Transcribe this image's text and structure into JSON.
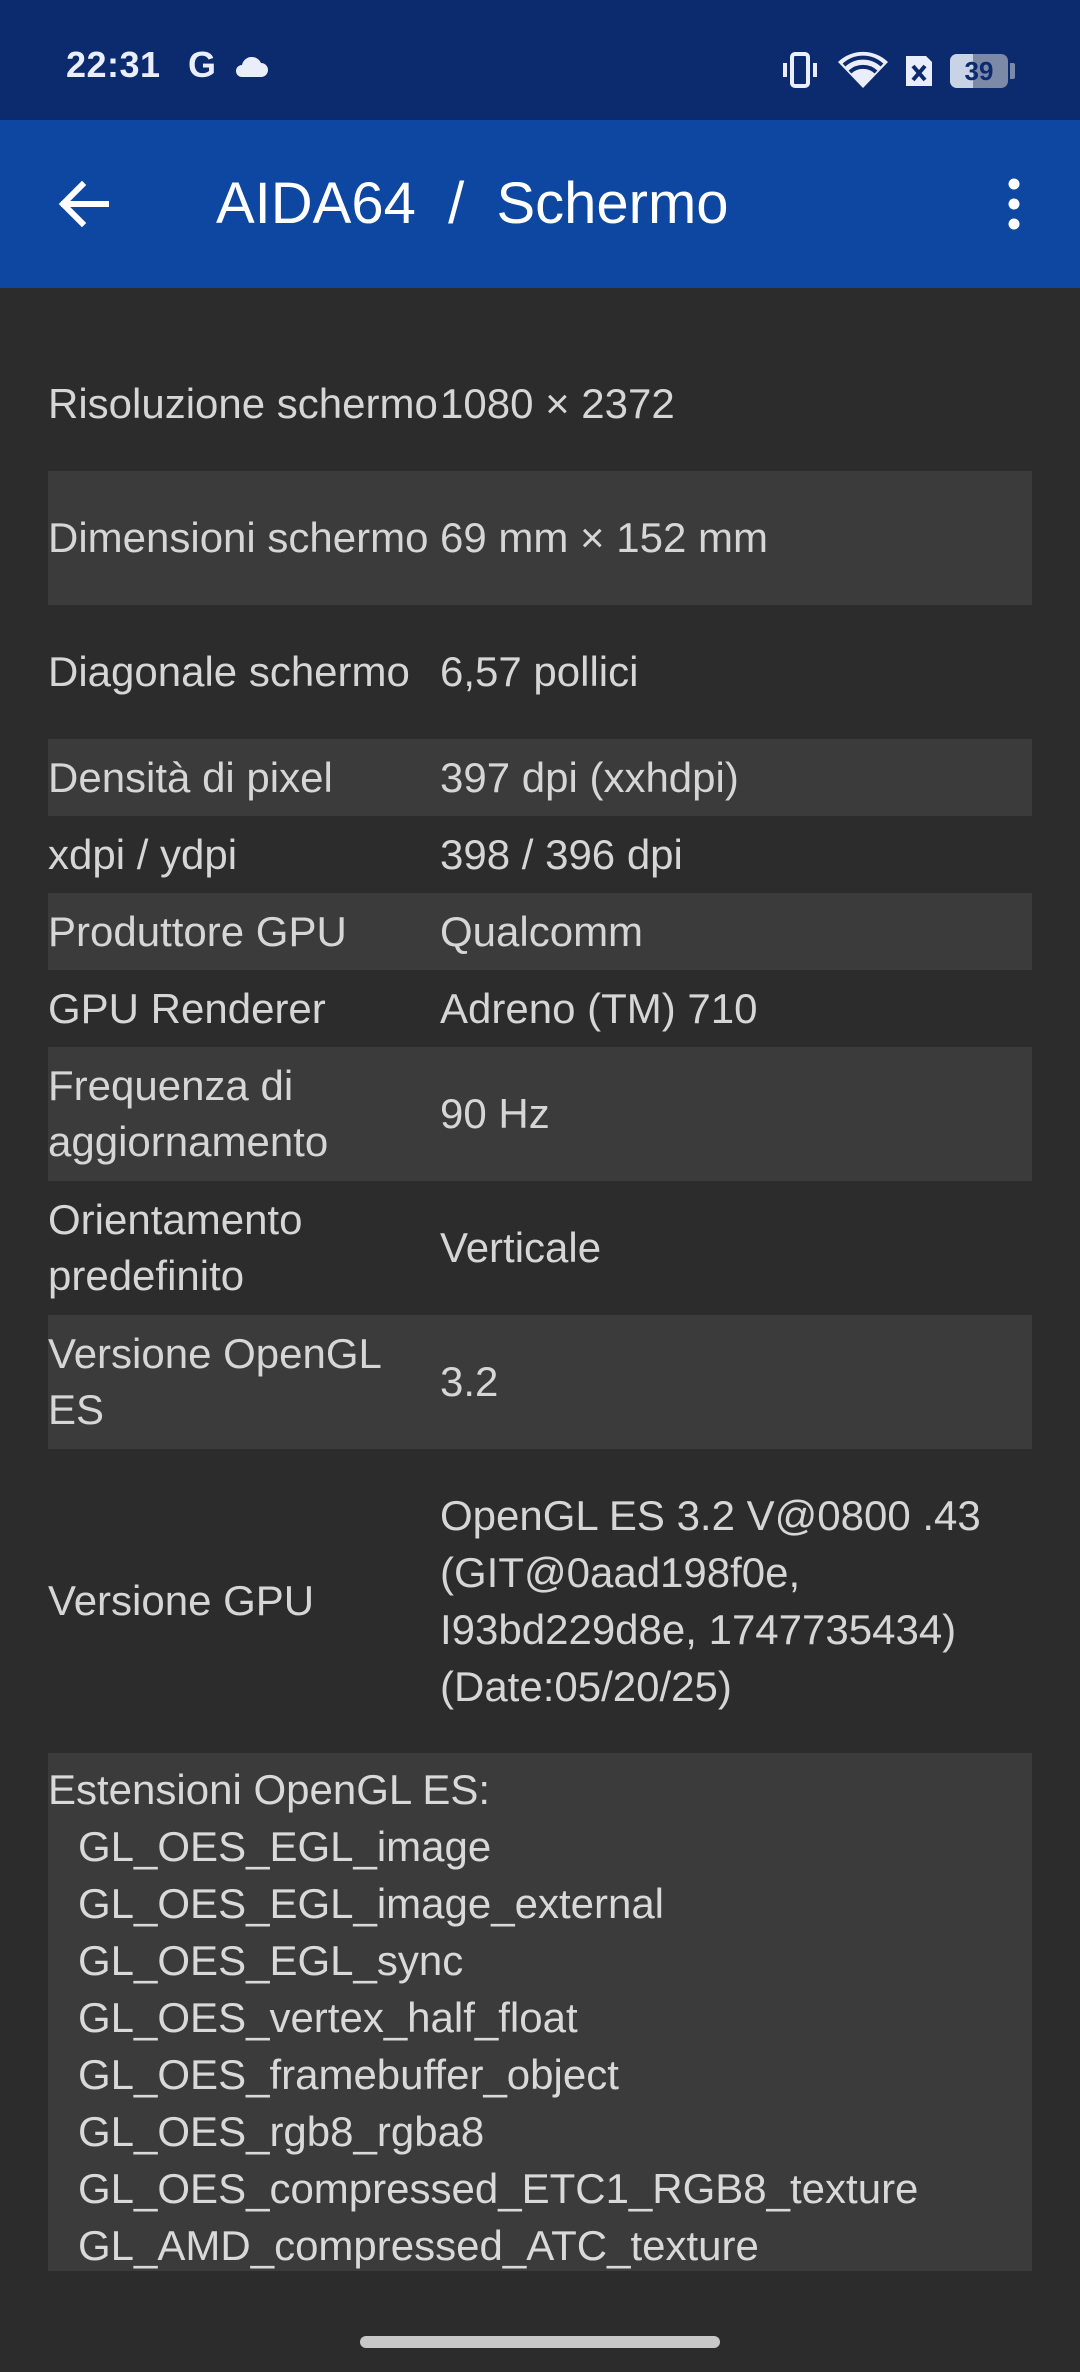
{
  "status_bar": {
    "time": "22:31",
    "g_label": "G",
    "battery_level": "39",
    "battery_fraction": 0.39,
    "icons": [
      "cloud-icon",
      "vibrate-icon",
      "wifi-icon",
      "sim-icon",
      "battery-icon"
    ]
  },
  "app_bar": {
    "title": "AIDA64  /  Schermo",
    "icons": [
      "back-arrow-icon",
      "more-vert-icon"
    ]
  },
  "rows": [
    {
      "label": "Risoluzione schermo",
      "value": "1080 × 2372"
    },
    {
      "label": "Dimensioni schermo",
      "value": "69 mm × 152 mm"
    },
    {
      "label": "Diagonale schermo",
      "value": "6,57 pollici"
    },
    {
      "label": "Densità di pixel",
      "value": "397 dpi (xxhdpi)"
    },
    {
      "label": "xdpi / ydpi",
      "value": "398 / 396 dpi"
    },
    {
      "label": "Produttore GPU",
      "value": "Qualcomm"
    },
    {
      "label": "GPU Renderer",
      "value": "Adreno (TM) 710"
    },
    {
      "label": "Frequenza di aggiornamento",
      "value": "90 Hz"
    },
    {
      "label": "Orientamento predefinito",
      "value": "Verticale"
    },
    {
      "label": "Versione OpenGL ES",
      "value": "3.2"
    },
    {
      "label": "Versione GPU",
      "value": "OpenGL ES 3.2 V@0800 .43 (GIT@0aad198f0e, I93bd229d8e, 1747735434) (Date:05/20/25)"
    }
  ],
  "extensions": {
    "title": "Estensioni OpenGL ES:",
    "items": [
      "GL_OES_EGL_image",
      "GL_OES_EGL_image_external",
      "GL_OES_EGL_sync",
      "GL_OES_vertex_half_float",
      "GL_OES_framebuffer_object",
      "GL_OES_rgb8_rgba8",
      "GL_OES_compressed_ETC1_RGB8_texture",
      "GL_AMD_compressed_ATC_texture"
    ]
  },
  "colors": {
    "status_bar_bg": "#0c2a6e",
    "app_bar_bg": "#0d47a1",
    "page_bg": "#2c2c2c",
    "alt_row_bg": "#3b3b3b",
    "text": "#d6d6d6"
  }
}
